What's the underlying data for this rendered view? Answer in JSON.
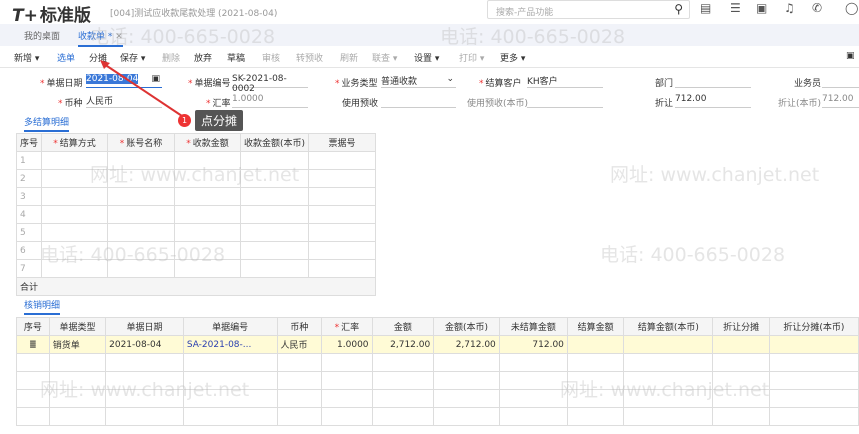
{
  "app": {
    "logo": "T+",
    "edition": "标准版",
    "subtitle": "[004]测试应收款尾款处理 (2021-08-04)",
    "search_placeholder": "搜索-产品功能"
  },
  "tabs": [
    {
      "label": "我的桌面"
    },
    {
      "label": "收款单 *"
    }
  ],
  "toolbar": [
    "新增 ▾",
    "选单",
    "分摊",
    "保存 ▾",
    "删除",
    "放弃",
    "草稿",
    "审核",
    "转预收",
    "刷新",
    "联查 ▾",
    "设置 ▾",
    "打印 ▾",
    "更多 ▾"
  ],
  "form": {
    "date_label": "单据日期",
    "date": "2021-08-04",
    "no_label": "单据编号",
    "no": "SK-2021-08-0002",
    "type_label": "业务类型",
    "type": "普通收款",
    "customer_label": "结算客户",
    "customer": "KH客户",
    "dept_label": "部门",
    "staff_label": "业务员",
    "currency_label": "币种",
    "currency": "人民币",
    "rate_label": "汇率",
    "rate": "1.0000",
    "prepay_label": "使用预收",
    "prepay_local_label": "使用预收(本币)",
    "discount_label": "折让",
    "discount": "712.00",
    "discount_local_label": "折让(本币)",
    "discount_local": "712.00"
  },
  "callout": {
    "num": "1",
    "text": "点分摊"
  },
  "multi": {
    "title": "多结算明细",
    "headers": [
      "序号",
      "结算方式",
      "账号名称",
      "收款金额",
      "收款金额(本币)",
      "票据号"
    ],
    "rows": [
      "1",
      "2",
      "3",
      "4",
      "5",
      "6",
      "7"
    ],
    "total": "合计"
  },
  "verify": {
    "title": "核销明细",
    "headers": [
      "序号",
      "单据类型",
      "单据日期",
      "单据编号",
      "币种",
      "汇率",
      "金额",
      "金额(本币)",
      "未结算金额",
      "结算金额",
      "结算金额(本币)",
      "折让分摊",
      "折让分摊(本币)"
    ],
    "row": [
      "销货单",
      "2021-08-04",
      "SA-2021-08-...",
      "人民币",
      "1.0000",
      "2,712.00",
      "2,712.00",
      "712.00",
      "",
      "",
      "",
      ""
    ]
  },
  "watermark": [
    "电话: 400-665-0028",
    "网址: www.chanjet.net"
  ]
}
